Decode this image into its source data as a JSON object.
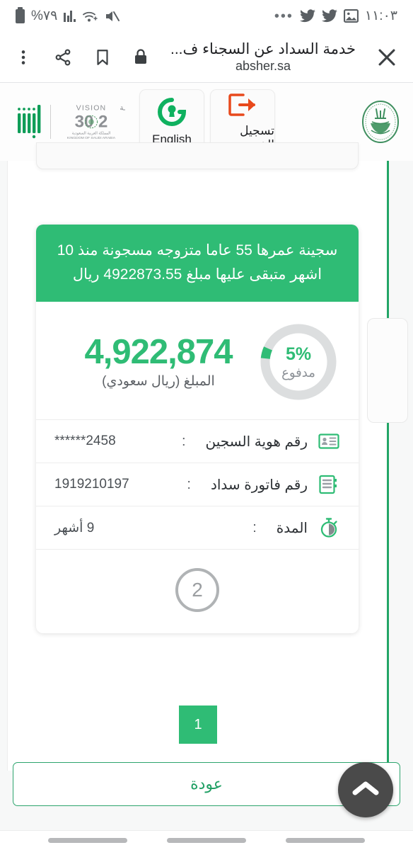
{
  "status_bar": {
    "battery_percent": "%٧٩",
    "time": "١١:٠٣",
    "icons": [
      "battery-icon",
      "signal-icon",
      "wifi-icon",
      "mute-icon",
      "overflow-dots-icon",
      "twitter-icon",
      "twitter-icon",
      "image-icon"
    ]
  },
  "browser": {
    "title": "خدمة السداد عن السجناء ف...",
    "url": "absher.sa",
    "menu_icon": "kebab-menu-icon",
    "share_icon": "share-icon",
    "bookmark_icon": "bookmark-icon",
    "lock_icon": "lock-icon",
    "close_icon": "close-icon"
  },
  "site_header": {
    "moi_logo": "ministry-of-interior-emblem",
    "logout_label": "تسجيل الخروج",
    "logout_icon": "logout-icon",
    "english_label": "English",
    "english_icon": "absher-keyhole-icon",
    "vision_top": "VISION",
    "vision_top_ar": "رؤيــــة",
    "vision_year": "2030",
    "vision_sub_ar": "المملكة العربية السعودية",
    "vision_sub_en": "KINGDOM OF SAUDI ARABIA",
    "absher_wordmark": "أبشر"
  },
  "card": {
    "header_text": "سجينة عمرها 55 عاما متزوجه مسجونة منذ 10 اشهر متبقى عليها مبلغ 4922873.55 ريال",
    "amount": "4,922,874",
    "amount_label": "المبلغ (ريال سعودي)",
    "gauge": {
      "percent_text": "5%",
      "label": "مدفوع",
      "value": 5,
      "track_color": "#dcdedf",
      "fill_color": "#2FBC75"
    },
    "rows": [
      {
        "icon": "id-card-icon",
        "label": "رقم هوية السجين",
        "colon": ":",
        "value": "******2458"
      },
      {
        "icon": "invoice-icon",
        "label": "رقم فاتورة سداد",
        "colon": ":",
        "value": "1919210197"
      },
      {
        "icon": "stopwatch-icon",
        "label": "المدة",
        "colon": ":",
        "value": "9 أشهر"
      }
    ],
    "step_badge": "2"
  },
  "pager": {
    "current_page": "1"
  },
  "footer": {
    "back_label": "عودة",
    "scroll_top_icon": "chevron-up-icon"
  },
  "nav_bar": {
    "pills": [
      "nav-pill",
      "nav-pill",
      "nav-pill"
    ]
  },
  "colors": {
    "brand_green": "#2FBC75",
    "accent_green": "#21a065",
    "border_green": "#23a566",
    "logout_orange": "#e8491c",
    "gray_text": "#5d6166"
  }
}
